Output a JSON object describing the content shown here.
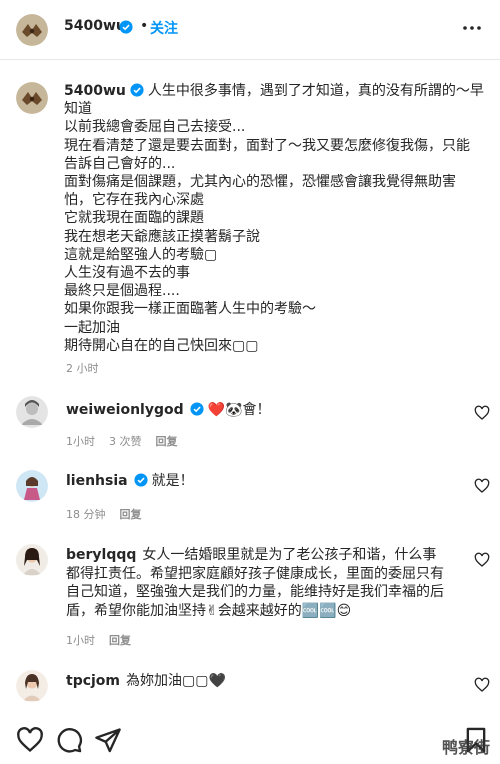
{
  "header": {
    "username": "5400wu",
    "separator": "•",
    "follow_label": "关注"
  },
  "caption": {
    "username": "5400wu",
    "lines": [
      "人生中很多事情，遇到了才知道，真的没有所謂的～早",
      "知道",
      "以前我總會委屈自己去接受...",
      "現在看清楚了還是要去面對，面對了～我又要怎麼修復我傷，只能",
      "告訴自己會好的...",
      "面對傷痛是個課題，尤其內心的恐懼，恐懼感會讓我覺得無助害",
      "怕，它存在我內心深處",
      "它就我現在面臨的課題",
      "我在想老天爺應該正摸著鬍子說",
      "這就是給堅強人的考驗▢",
      "人生沒有過不去的事",
      "最終只是個過程....",
      "如果你跟我一樣正面臨著人生中的考驗～",
      "一起加油",
      "期待開心自在的自己快回來▢▢"
    ],
    "time": "2 小时"
  },
  "comments": [
    {
      "username": "weiweionlygod",
      "verified": true,
      "text": "❤️🐼會！",
      "time": "1小时",
      "likes": "3 次赞",
      "reply": "回复"
    },
    {
      "username": "lienhsia",
      "verified": true,
      "text": "就是！",
      "time": "18 分钟",
      "likes": "",
      "reply": "回复"
    },
    {
      "username": "berylqqq",
      "verified": false,
      "lines": [
        "女人一结婚眼里就是为了老公孩子和谐，什么事",
        "都得扛责任。希望把家庭顧好孩子健康成长，里面的委屈只有",
        "自己知道，堅強強大是我们的力量，能维持好是我们幸福的后",
        "盾，希望你能加油坚持✌会越来越好的🆒🆒😊"
      ],
      "time": "1小时",
      "likes": "",
      "reply": "回复"
    },
    {
      "username": "tpcjom",
      "verified": false,
      "text": "為妳加油▢▢🖤"
    }
  ],
  "watermark": "鸭寮街",
  "colors": {
    "accent": "#0095f6",
    "muted": "#8e8e8e",
    "text": "#262626"
  }
}
